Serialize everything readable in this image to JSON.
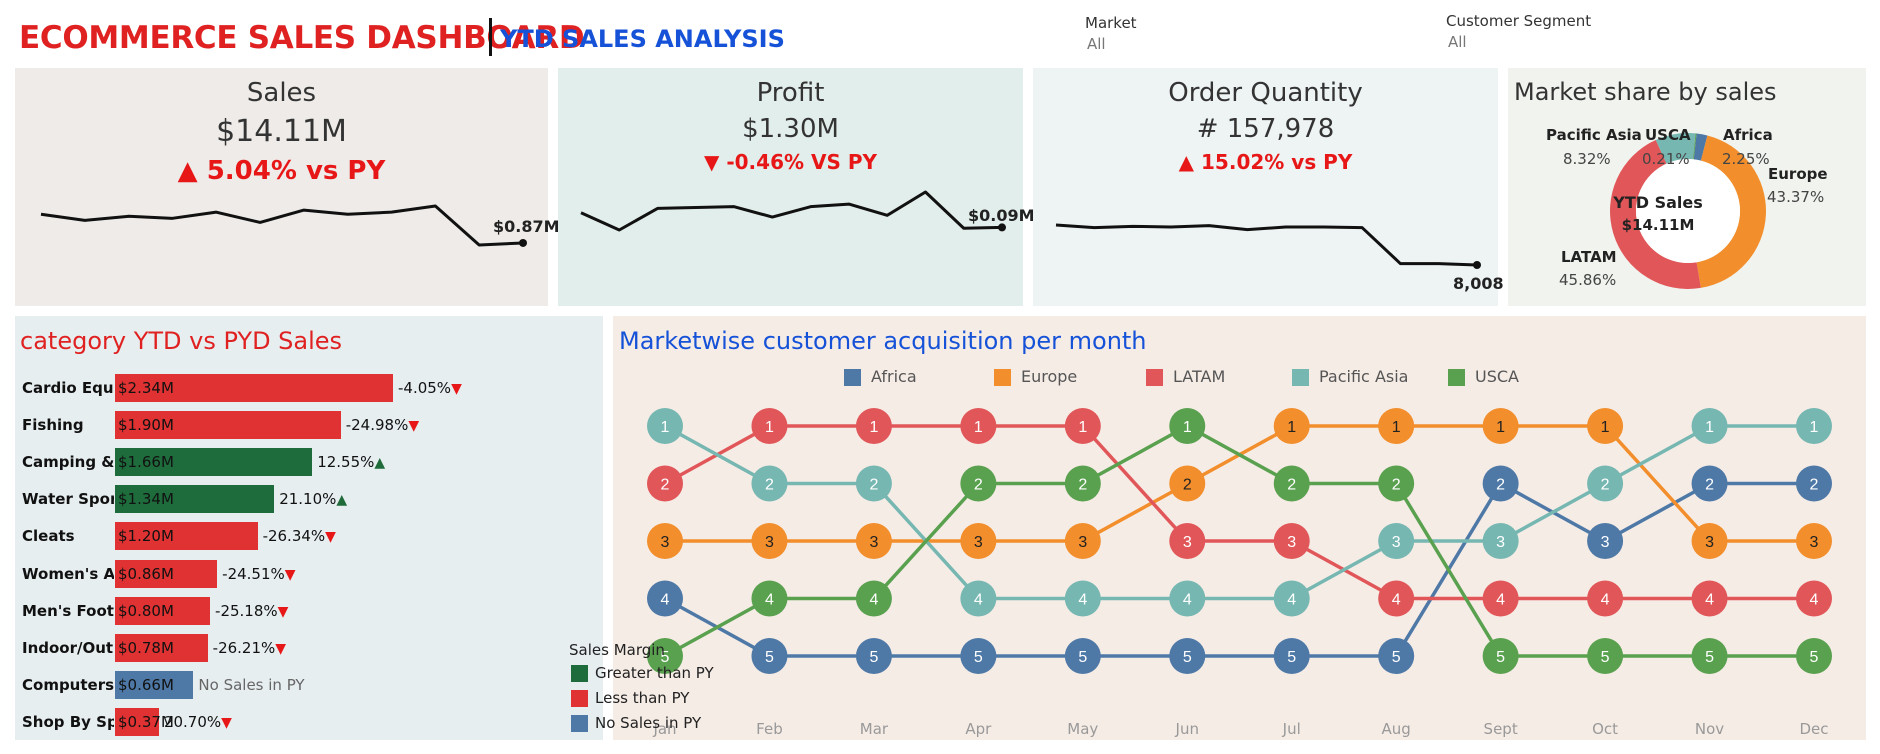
{
  "header": {
    "title": "ECOMMERCE SALES DASHBOARD",
    "subtitle": "YTD SALES ANALYSIS"
  },
  "filters": {
    "market": {
      "label": "Market",
      "value": "All"
    },
    "segment": {
      "label": "Customer Segment",
      "value": "All"
    }
  },
  "colors": {
    "title_red": "#e02121",
    "title_blue": "#1552d8",
    "africa": "#4e79a7",
    "europe": "#f28e2b",
    "latam": "#e15759",
    "pacific_asia": "#76b7b2",
    "usca": "#59a14f",
    "greater_than_py": "#1e6b3c",
    "less_than_py": "#e03232",
    "no_sales_py": "#4e79a7"
  },
  "kpis": {
    "sales": {
      "title": "Sales",
      "value": "$14.11M",
      "delta": "▲ 5.04% vs PY",
      "last_label": "$0.87M",
      "trend": [
        0.87,
        0.84,
        0.86,
        0.85,
        0.88,
        0.83,
        0.89,
        0.87,
        0.88,
        0.91,
        0.72,
        0.73
      ]
    },
    "profit": {
      "title": "Profit",
      "value": "$1.30M",
      "delta": "▼ -0.46% VS PY",
      "last_label": "$0.09M",
      "trend": [
        0.11,
        0.09,
        0.115,
        0.116,
        0.117,
        0.105,
        0.117,
        0.12,
        0.107,
        0.134,
        0.092,
        0.093
      ]
    },
    "orders": {
      "title": "Order Quantity",
      "value": "# 157,978",
      "delta": "▲ 15.02% vs PY",
      "last_label": "8,008",
      "trend": [
        14.0,
        13.6,
        13.8,
        13.7,
        13.9,
        13.3,
        13.7,
        13.7,
        13.6,
        8.2,
        8.2,
        8.0
      ]
    }
  },
  "market_share": {
    "title": "Market share by sales",
    "center_label": "YTD Sales",
    "center_value": "$14.11M",
    "slices": [
      {
        "name": "Africa",
        "pct": "2.25%",
        "value": 2.25
      },
      {
        "name": "Europe",
        "pct": "43.37%",
        "value": 43.37
      },
      {
        "name": "LATAM",
        "pct": "45.86%",
        "value": 45.86
      },
      {
        "name": "Pacific Asia",
        "pct": "8.32%",
        "value": 8.32
      },
      {
        "name": "USCA",
        "pct": "0.21%",
        "value": 0.21
      }
    ]
  },
  "category": {
    "title": "category YTD vs PYD Sales",
    "rows": [
      {
        "name": "Cardio Equi..",
        "value_label": "$2.34M",
        "value": 2.34,
        "change": "-4.05%",
        "dir": "down",
        "status": "less"
      },
      {
        "name": "Fishing",
        "value_label": "$1.90M",
        "value": 1.9,
        "change": "-24.98%",
        "dir": "down",
        "status": "less"
      },
      {
        "name": "Camping & ..",
        "value_label": "$1.66M",
        "value": 1.66,
        "change": "12.55%",
        "dir": "up",
        "status": "greater"
      },
      {
        "name": "Water Spor..",
        "value_label": "$1.34M",
        "value": 1.34,
        "change": "21.10%",
        "dir": "up",
        "status": "greater"
      },
      {
        "name": "Cleats",
        "value_label": "$1.20M",
        "value": 1.2,
        "change": "-26.34%",
        "dir": "down",
        "status": "less"
      },
      {
        "name": "Women's A..",
        "value_label": "$0.86M",
        "value": 0.86,
        "change": "-24.51%",
        "dir": "down",
        "status": "less"
      },
      {
        "name": "Men's Foot..",
        "value_label": "$0.80M",
        "value": 0.8,
        "change": "-25.18%",
        "dir": "down",
        "status": "less"
      },
      {
        "name": "Indoor/Out..",
        "value_label": "$0.78M",
        "value": 0.78,
        "change": "-26.21%",
        "dir": "down",
        "status": "less"
      },
      {
        "name": "Computers",
        "value_label": "$0.66M",
        "value": 0.66,
        "change": "No Sales in PY",
        "dir": "none",
        "status": "none"
      },
      {
        "name": "Shop By Sp..",
        "value_label": "$0.37M",
        "value": 0.37,
        "change": "20.70%",
        "dir": "down",
        "status": "less"
      }
    ],
    "legend_title": "Sales Margin",
    "legend": [
      {
        "key": "greater",
        "label": "Greater than PY"
      },
      {
        "key": "less",
        "label": "Less than PY"
      },
      {
        "key": "none",
        "label": "No Sales in PY"
      }
    ]
  },
  "chart_data": {
    "type": "line",
    "title": "Marketwise customer acquisition per month",
    "x": [
      "Jan",
      "Feb",
      "Mar",
      "Apr",
      "May",
      "Jun",
      "Jul",
      "Aug",
      "Sept",
      "Oct",
      "Nov",
      "Dec"
    ],
    "ylim": [
      1,
      5
    ],
    "y_reversed": true,
    "series": [
      {
        "name": "Africa",
        "values": [
          4,
          5,
          5,
          5,
          5,
          5,
          5,
          5,
          2,
          3,
          2,
          2
        ]
      },
      {
        "name": "Europe",
        "values": [
          3,
          3,
          3,
          3,
          3,
          2,
          1,
          1,
          1,
          1,
          3,
          3
        ]
      },
      {
        "name": "LATAM",
        "values": [
          2,
          1,
          1,
          1,
          1,
          3,
          3,
          4,
          4,
          4,
          4,
          4
        ]
      },
      {
        "name": "Pacific Asia",
        "values": [
          1,
          2,
          2,
          4,
          4,
          4,
          4,
          3,
          3,
          2,
          1,
          1
        ]
      },
      {
        "name": "USCA",
        "values": [
          5,
          4,
          4,
          2,
          2,
          1,
          2,
          2,
          5,
          5,
          5,
          5
        ]
      }
    ]
  }
}
